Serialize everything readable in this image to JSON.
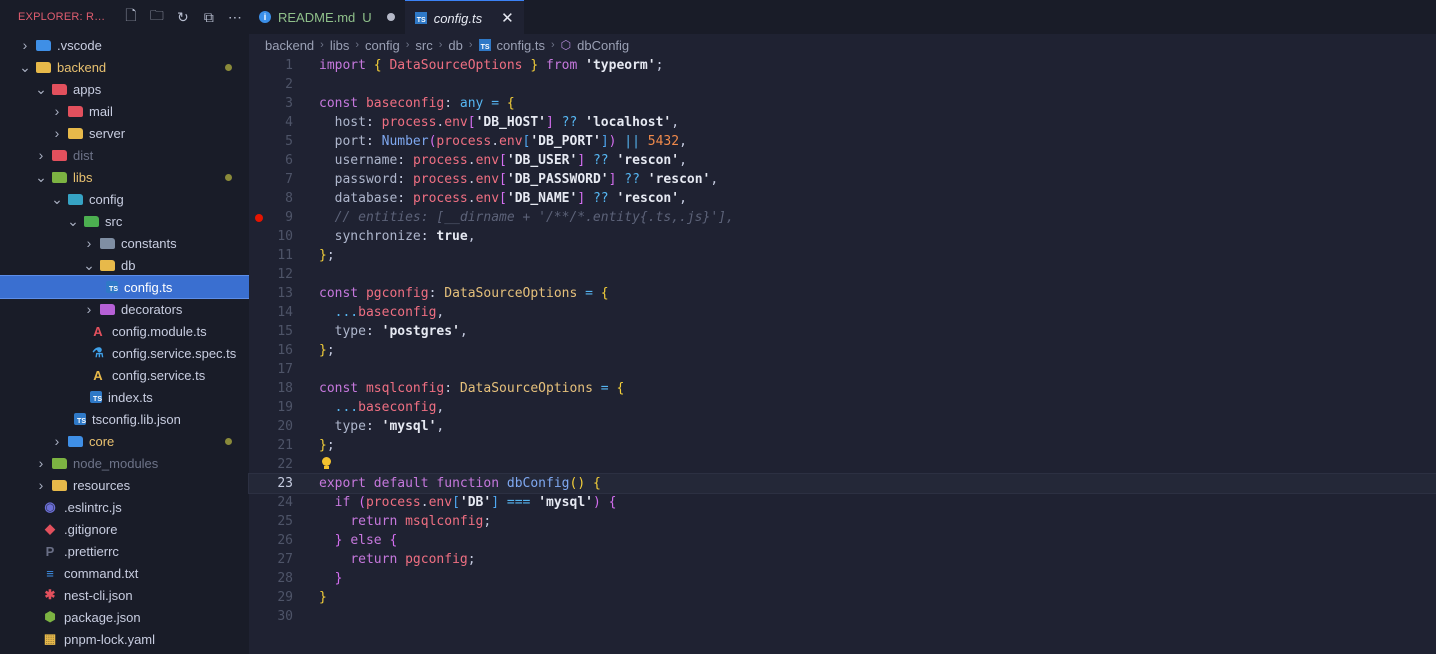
{
  "explorer": {
    "title": "EXPLORER: RESC...",
    "actions": [
      {
        "icon": "new-file-icon",
        "glyph": "🗋"
      },
      {
        "icon": "new-folder-icon",
        "glyph": "🗀"
      },
      {
        "icon": "refresh-icon",
        "glyph": "↻"
      },
      {
        "icon": "collapse-all-icon",
        "glyph": "⧉"
      },
      {
        "icon": "more-icon",
        "glyph": "⋯"
      }
    ],
    "items": [
      {
        "label": ".vscode",
        "depth": 0,
        "kind": "folder",
        "chev": "›",
        "color": "#3f8fe6",
        "name": "tree-item-vscode"
      },
      {
        "label": "backend",
        "depth": 0,
        "kind": "folder-open",
        "chev": "⌄",
        "color": "#e7b94a",
        "hl": true,
        "dot": true,
        "name": "tree-item-backend"
      },
      {
        "label": "apps",
        "depth": 1,
        "kind": "folder-open",
        "chev": "⌄",
        "color": "#e2505d",
        "name": "tree-item-apps"
      },
      {
        "label": "mail",
        "depth": 2,
        "kind": "folder",
        "chev": "›",
        "color": "#e2505d",
        "name": "tree-item-mail"
      },
      {
        "label": "server",
        "depth": 2,
        "kind": "folder",
        "chev": "›",
        "color": "#e7b94a",
        "name": "tree-item-server"
      },
      {
        "label": "dist",
        "depth": 1,
        "kind": "folder",
        "chev": "›",
        "color": "#e2505d",
        "dim": true,
        "name": "tree-item-dist"
      },
      {
        "label": "libs",
        "depth": 1,
        "kind": "folder-open",
        "chev": "⌄",
        "color": "#7cb342",
        "hl": true,
        "dot": true,
        "name": "tree-item-libs"
      },
      {
        "label": "config",
        "depth": 2,
        "kind": "folder-open",
        "chev": "⌄",
        "color": "#36a3c4",
        "name": "tree-item-config"
      },
      {
        "label": "src",
        "depth": 3,
        "kind": "folder-open",
        "chev": "⌄",
        "color": "#4caf50",
        "name": "tree-item-src"
      },
      {
        "label": "constants",
        "depth": 4,
        "kind": "folder",
        "chev": "›",
        "color": "#7f8ea3",
        "name": "tree-item-constants"
      },
      {
        "label": "db",
        "depth": 4,
        "kind": "folder-open",
        "chev": "⌄",
        "color": "#e7b94a",
        "name": "tree-item-db"
      },
      {
        "label": "config.ts",
        "depth": 5,
        "kind": "file",
        "glyph": "TS",
        "color": "#2f79c7",
        "selected": true,
        "name": "tree-item-config-ts"
      },
      {
        "label": "decorators",
        "depth": 4,
        "kind": "folder",
        "chev": "›",
        "color": "#b660d6",
        "name": "tree-item-decorators"
      },
      {
        "label": "config.module.ts",
        "depth": 4,
        "kind": "file",
        "glyph": "A",
        "color": "#e2505d",
        "name": "tree-item-config-module"
      },
      {
        "label": "config.service.spec.ts",
        "depth": 4,
        "kind": "file",
        "glyph": "⚗",
        "color": "#3fa0e8",
        "name": "tree-item-config-service-spec"
      },
      {
        "label": "config.service.ts",
        "depth": 4,
        "kind": "file",
        "glyph": "A",
        "color": "#e7b94a",
        "name": "tree-item-config-service"
      },
      {
        "label": "index.ts",
        "depth": 4,
        "kind": "file",
        "glyph": "TS",
        "color": "#2f79c7",
        "name": "tree-item-index-ts"
      },
      {
        "label": "tsconfig.lib.json",
        "depth": 3,
        "kind": "file",
        "glyph": "TS",
        "color": "#2f79c7",
        "name": "tree-item-tsconfig-lib"
      },
      {
        "label": "core",
        "depth": 2,
        "kind": "folder",
        "chev": "›",
        "color": "#3f8fe6",
        "hl": true,
        "dot": true,
        "name": "tree-item-core"
      },
      {
        "label": "node_modules",
        "depth": 1,
        "kind": "folder",
        "chev": "›",
        "color": "#7cb342",
        "dim": true,
        "name": "tree-item-node-modules"
      },
      {
        "label": "resources",
        "depth": 1,
        "kind": "folder",
        "chev": "›",
        "color": "#e7b94a",
        "name": "tree-item-resources"
      },
      {
        "label": ".eslintrc.js",
        "depth": 1,
        "kind": "file",
        "glyph": "◉",
        "color": "#6c6fd6",
        "name": "tree-item-eslintrc"
      },
      {
        "label": ".gitignore",
        "depth": 1,
        "kind": "file",
        "glyph": "◆",
        "color": "#e2505d",
        "name": "tree-item-gitignore"
      },
      {
        "label": ".prettierrc",
        "depth": 1,
        "kind": "file",
        "glyph": "P",
        "color": "#6a6f86",
        "name": "tree-item-prettierrc"
      },
      {
        "label": "command.txt",
        "depth": 1,
        "kind": "file",
        "glyph": "≡",
        "color": "#3f8fe6",
        "name": "tree-item-command-txt"
      },
      {
        "label": "nest-cli.json",
        "depth": 1,
        "kind": "file",
        "glyph": "✱",
        "color": "#e2505d",
        "name": "tree-item-nest-cli"
      },
      {
        "label": "package.json",
        "depth": 1,
        "kind": "file",
        "glyph": "⬢",
        "color": "#7cb342",
        "name": "tree-item-package-json"
      },
      {
        "label": "pnpm-lock.yaml",
        "depth": 1,
        "kind": "file",
        "glyph": "▦",
        "color": "#e7b94a",
        "name": "tree-item-pnpm-lock"
      }
    ]
  },
  "tabs": [
    {
      "label": "README.md",
      "status": "U",
      "icon": "info-icon",
      "active": false
    },
    {
      "label": "config.ts",
      "icon": "typescript-icon",
      "active": true
    }
  ],
  "breadcrumb": [
    "backend",
    "libs",
    "config",
    "src",
    "db",
    "config.ts",
    "dbConfig"
  ],
  "editor": {
    "current_line": 23,
    "breakpoint_line": 9,
    "lightbulb_line": 22,
    "lines": [
      [
        [
          "kw",
          "import"
        ],
        [
          "plain",
          " "
        ],
        [
          "br1",
          "{"
        ],
        [
          "plain",
          " "
        ],
        [
          "var",
          "DataSourceOptions"
        ],
        [
          "plain",
          " "
        ],
        [
          "br1",
          "}"
        ],
        [
          "plain",
          " "
        ],
        [
          "kw",
          "from"
        ],
        [
          "plain",
          " "
        ],
        [
          "str",
          "'typeorm'"
        ],
        [
          "plain",
          ";"
        ]
      ],
      [],
      [
        [
          "kw",
          "const"
        ],
        [
          "plain",
          " "
        ],
        [
          "var",
          "baseconfig"
        ],
        [
          "plain",
          ": "
        ],
        [
          "op",
          "any"
        ],
        [
          "plain",
          " "
        ],
        [
          "op",
          "="
        ],
        [
          "plain",
          " "
        ],
        [
          "br1",
          "{"
        ]
      ],
      [
        [
          "plain",
          "  "
        ],
        [
          "prop",
          "host"
        ],
        [
          "plain",
          ": "
        ],
        [
          "var",
          "process"
        ],
        [
          "plain",
          "."
        ],
        [
          "var",
          "env"
        ],
        [
          "br2",
          "["
        ],
        [
          "str",
          "'DB_HOST'"
        ],
        [
          "br2",
          "]"
        ],
        [
          "plain",
          " "
        ],
        [
          "op",
          "??"
        ],
        [
          "plain",
          " "
        ],
        [
          "str",
          "'localhost'"
        ],
        [
          "plain",
          ","
        ]
      ],
      [
        [
          "plain",
          "  "
        ],
        [
          "prop",
          "port"
        ],
        [
          "plain",
          ": "
        ],
        [
          "fn",
          "Number"
        ],
        [
          "br2",
          "("
        ],
        [
          "var",
          "process"
        ],
        [
          "plain",
          "."
        ],
        [
          "var",
          "env"
        ],
        [
          "br3",
          "["
        ],
        [
          "str",
          "'DB_PORT'"
        ],
        [
          "br3",
          "]"
        ],
        [
          "br2",
          ")"
        ],
        [
          "plain",
          " "
        ],
        [
          "op",
          "||"
        ],
        [
          "plain",
          " "
        ],
        [
          "num",
          "5432"
        ],
        [
          "plain",
          ","
        ]
      ],
      [
        [
          "plain",
          "  "
        ],
        [
          "prop",
          "username"
        ],
        [
          "plain",
          ": "
        ],
        [
          "var",
          "process"
        ],
        [
          "plain",
          "."
        ],
        [
          "var",
          "env"
        ],
        [
          "br2",
          "["
        ],
        [
          "str",
          "'DB_USER'"
        ],
        [
          "br2",
          "]"
        ],
        [
          "plain",
          " "
        ],
        [
          "op",
          "??"
        ],
        [
          "plain",
          " "
        ],
        [
          "str",
          "'rescon'"
        ],
        [
          "plain",
          ","
        ]
      ],
      [
        [
          "plain",
          "  "
        ],
        [
          "prop",
          "password"
        ],
        [
          "plain",
          ": "
        ],
        [
          "var",
          "process"
        ],
        [
          "plain",
          "."
        ],
        [
          "var",
          "env"
        ],
        [
          "br2",
          "["
        ],
        [
          "str",
          "'DB_PASSWORD'"
        ],
        [
          "br2",
          "]"
        ],
        [
          "plain",
          " "
        ],
        [
          "op",
          "??"
        ],
        [
          "plain",
          " "
        ],
        [
          "str",
          "'rescon'"
        ],
        [
          "plain",
          ","
        ]
      ],
      [
        [
          "plain",
          "  "
        ],
        [
          "prop",
          "database"
        ],
        [
          "plain",
          ": "
        ],
        [
          "var",
          "process"
        ],
        [
          "plain",
          "."
        ],
        [
          "var",
          "env"
        ],
        [
          "br2",
          "["
        ],
        [
          "str",
          "'DB_NAME'"
        ],
        [
          "br2",
          "]"
        ],
        [
          "plain",
          " "
        ],
        [
          "op",
          "??"
        ],
        [
          "plain",
          " "
        ],
        [
          "str",
          "'rescon'"
        ],
        [
          "plain",
          ","
        ]
      ],
      [
        [
          "plain",
          "  "
        ],
        [
          "cmt",
          "// entities: [__dirname + '/**/*.entity{.ts,.js}'],"
        ]
      ],
      [
        [
          "plain",
          "  "
        ],
        [
          "prop",
          "synchronize"
        ],
        [
          "plain",
          ": "
        ],
        [
          "str",
          "true"
        ],
        [
          "plain",
          ","
        ]
      ],
      [
        [
          "br1",
          "}"
        ],
        [
          "plain",
          ";"
        ]
      ],
      [],
      [
        [
          "kw",
          "const"
        ],
        [
          "plain",
          " "
        ],
        [
          "var",
          "pgconfig"
        ],
        [
          "plain",
          ": "
        ],
        [
          "type",
          "DataSourceOptions"
        ],
        [
          "plain",
          " "
        ],
        [
          "op",
          "="
        ],
        [
          "plain",
          " "
        ],
        [
          "br1",
          "{"
        ]
      ],
      [
        [
          "plain",
          "  "
        ],
        [
          "op",
          "..."
        ],
        [
          "var",
          "baseconfig"
        ],
        [
          "plain",
          ","
        ]
      ],
      [
        [
          "plain",
          "  "
        ],
        [
          "prop",
          "type"
        ],
        [
          "plain",
          ": "
        ],
        [
          "str",
          "'postgres'"
        ],
        [
          "plain",
          ","
        ]
      ],
      [
        [
          "br1",
          "}"
        ],
        [
          "plain",
          ";"
        ]
      ],
      [],
      [
        [
          "kw",
          "const"
        ],
        [
          "plain",
          " "
        ],
        [
          "var",
          "msqlconfig"
        ],
        [
          "plain",
          ": "
        ],
        [
          "type",
          "DataSourceOptions"
        ],
        [
          "plain",
          " "
        ],
        [
          "op",
          "="
        ],
        [
          "plain",
          " "
        ],
        [
          "br1",
          "{"
        ]
      ],
      [
        [
          "plain",
          "  "
        ],
        [
          "op",
          "..."
        ],
        [
          "var",
          "baseconfig"
        ],
        [
          "plain",
          ","
        ]
      ],
      [
        [
          "plain",
          "  "
        ],
        [
          "prop",
          "type"
        ],
        [
          "plain",
          ": "
        ],
        [
          "str",
          "'mysql'"
        ],
        [
          "plain",
          ","
        ]
      ],
      [
        [
          "br1",
          "}"
        ],
        [
          "plain",
          ";"
        ]
      ],
      [],
      [
        [
          "kw",
          "export"
        ],
        [
          "plain",
          " "
        ],
        [
          "kw",
          "default"
        ],
        [
          "plain",
          " "
        ],
        [
          "kw",
          "function"
        ],
        [
          "plain",
          " "
        ],
        [
          "fn",
          "dbConfig"
        ],
        [
          "br1",
          "()"
        ],
        [
          "plain",
          " "
        ],
        [
          "br1",
          "{"
        ]
      ],
      [
        [
          "plain",
          "  "
        ],
        [
          "kw",
          "if"
        ],
        [
          "plain",
          " "
        ],
        [
          "br2",
          "("
        ],
        [
          "var",
          "process"
        ],
        [
          "plain",
          "."
        ],
        [
          "var",
          "env"
        ],
        [
          "br3",
          "["
        ],
        [
          "str",
          "'DB'"
        ],
        [
          "br3",
          "]"
        ],
        [
          "plain",
          " "
        ],
        [
          "op",
          "==="
        ],
        [
          "plain",
          " "
        ],
        [
          "str",
          "'mysql'"
        ],
        [
          "br2",
          ")"
        ],
        [
          "plain",
          " "
        ],
        [
          "br2",
          "{"
        ]
      ],
      [
        [
          "plain",
          "    "
        ],
        [
          "kw",
          "return"
        ],
        [
          "plain",
          " "
        ],
        [
          "var",
          "msqlconfig"
        ],
        [
          "plain",
          ";"
        ]
      ],
      [
        [
          "plain",
          "  "
        ],
        [
          "br2",
          "}"
        ],
        [
          "plain",
          " "
        ],
        [
          "kw",
          "else"
        ],
        [
          "plain",
          " "
        ],
        [
          "br2",
          "{"
        ]
      ],
      [
        [
          "plain",
          "    "
        ],
        [
          "kw",
          "return"
        ],
        [
          "plain",
          " "
        ],
        [
          "var",
          "pgconfig"
        ],
        [
          "plain",
          ";"
        ]
      ],
      [
        [
          "plain",
          "  "
        ],
        [
          "br2",
          "}"
        ]
      ],
      [
        [
          "br1",
          "}"
        ]
      ],
      []
    ]
  }
}
